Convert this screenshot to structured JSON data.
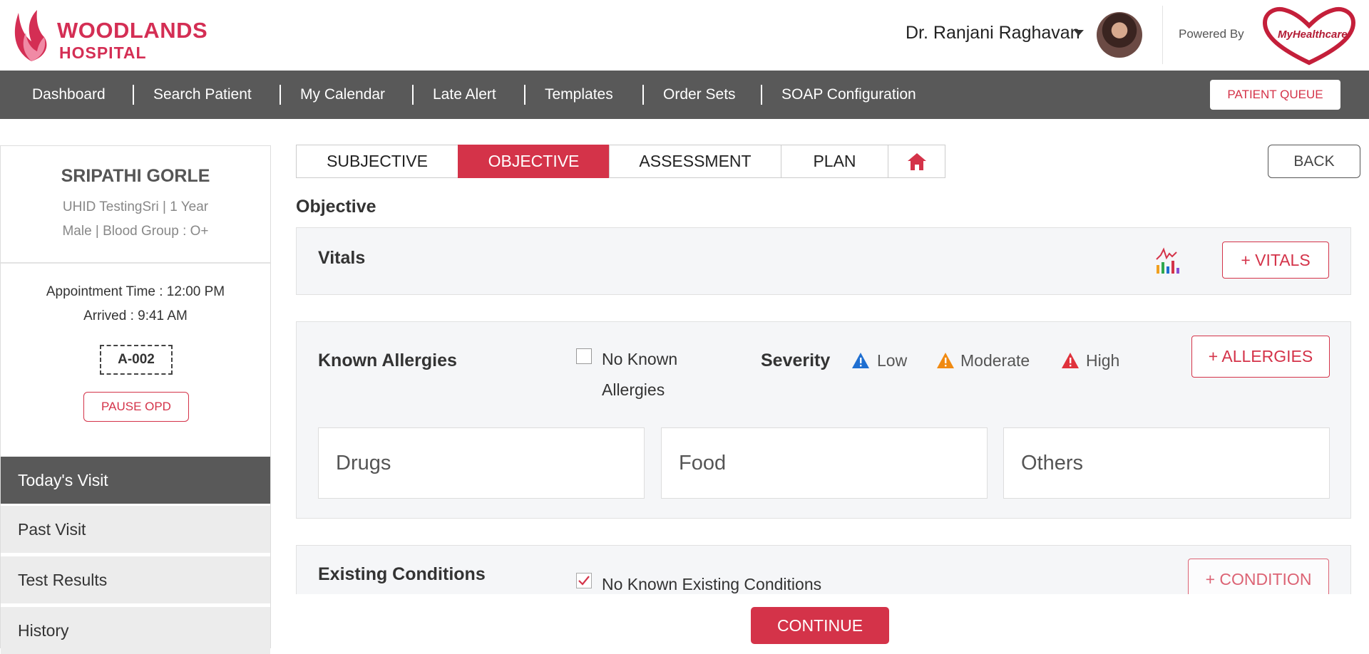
{
  "header": {
    "logo_line1": "WOODLANDS",
    "logo_line2": "HOSPITAL",
    "doctor_name": "Dr. Ranjani Raghavan",
    "powered_by": "Powered By",
    "partner_logo_text": "MyHealthcare"
  },
  "nav": {
    "items": [
      "Dashboard",
      "Search Patient",
      "My Calendar",
      "Late Alert",
      "Templates",
      "Order Sets",
      "SOAP Configuration"
    ],
    "patient_queue": "PATIENT QUEUE"
  },
  "patient": {
    "name": "SRIPATHI GORLE",
    "uhid_line": "UHID TestingSri | 1 Year",
    "gender_line": "Male | Blood Group : O+",
    "appointment_time": "Appointment Time : 12:00 PM",
    "arrived": "Arrived : 9:41 AM",
    "token": "A-002",
    "pause_label": "PAUSE OPD"
  },
  "sidebar": {
    "items": [
      "Today's Visit",
      "Past Visit",
      "Test Results",
      "History"
    ],
    "active": "Today's Visit"
  },
  "tabs": {
    "items": [
      "SUBJECTIVE",
      "OBJECTIVE",
      "ASSESSMENT",
      "PLAN"
    ],
    "active": "OBJECTIVE"
  },
  "back_label": "BACK",
  "section_title": "Objective",
  "vitals": {
    "title": "Vitals",
    "add_label": "+ VITALS"
  },
  "allergies": {
    "title": "Known Allergies",
    "no_known_line1": "No Known",
    "no_known_line2": "Allergies",
    "no_known_checked": false,
    "severity_label": "Severity",
    "severity_levels": [
      {
        "label": "Low",
        "color": "#1f6fd1"
      },
      {
        "label": "Moderate",
        "color": "#f08a12"
      },
      {
        "label": "High",
        "color": "#e0323c"
      }
    ],
    "add_label": "+ ALLERGIES",
    "boxes": [
      "Drugs",
      "Food",
      "Others"
    ]
  },
  "conditions": {
    "title": "Existing Conditions",
    "no_known_label": "No Known Existing Conditions",
    "no_known_checked": true,
    "add_label": "+ CONDITION"
  },
  "continue_label": "CONTINUE",
  "colors": {
    "accent": "#d43349",
    "nav_bg": "#595959"
  }
}
